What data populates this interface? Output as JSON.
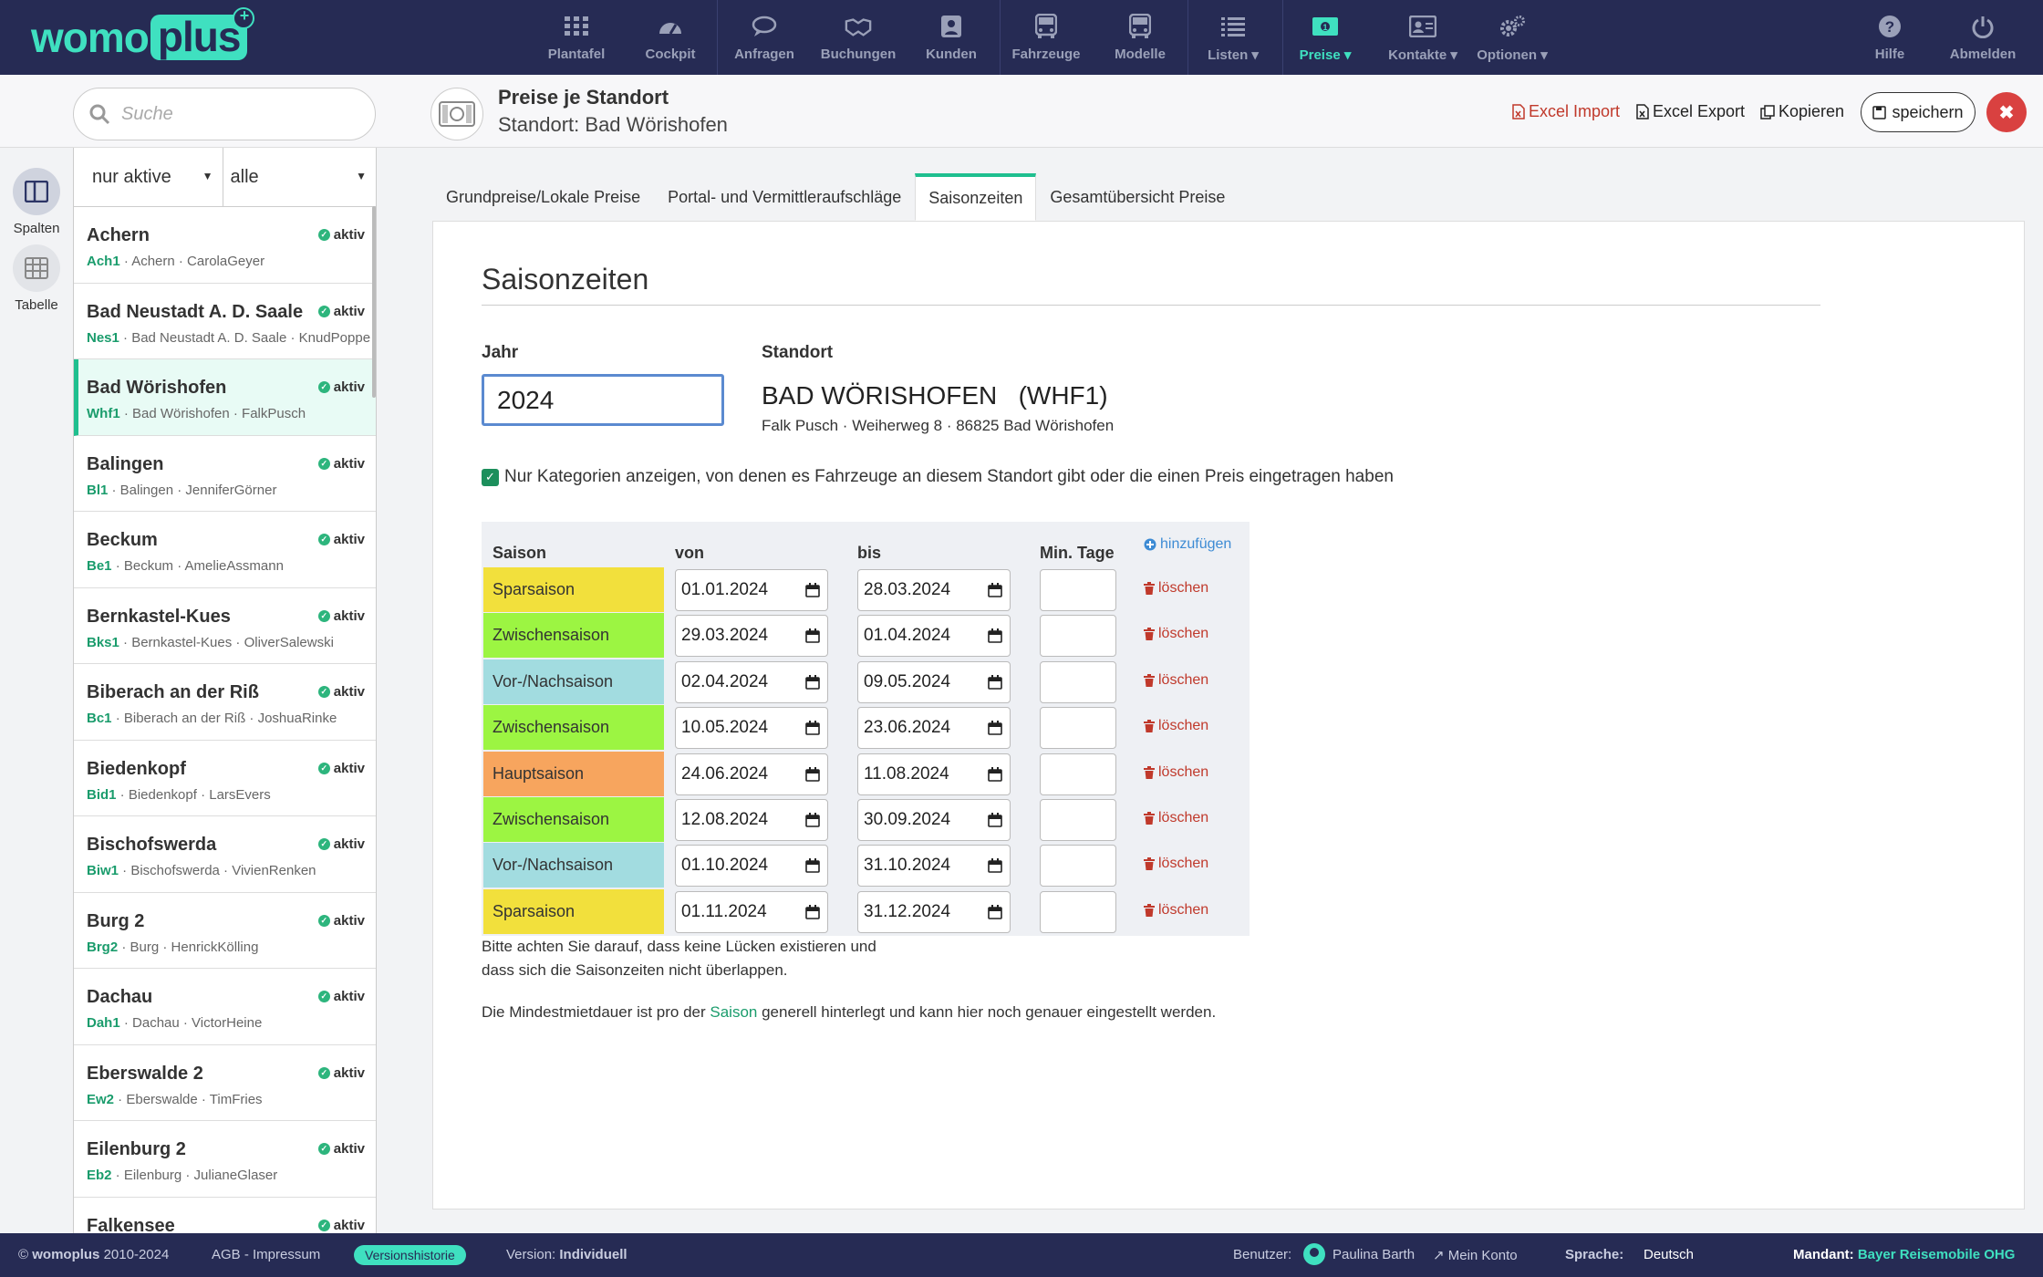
{
  "app": {
    "logo_a": "womo",
    "logo_b": "plus"
  },
  "nav": {
    "items": [
      {
        "label": "Plantafel",
        "icon": "grid-icon"
      },
      {
        "label": "Cockpit",
        "icon": "gauge-icon"
      },
      {
        "label": "Anfragen",
        "icon": "chat-icon"
      },
      {
        "label": "Buchungen",
        "icon": "handshake-icon"
      },
      {
        "label": "Kunden",
        "icon": "person-card-icon"
      },
      {
        "label": "Fahrzeuge",
        "icon": "bus-icon"
      },
      {
        "label": "Modelle",
        "icon": "bus-icon"
      },
      {
        "label": "Listen ▾",
        "icon": "list-icon"
      },
      {
        "label": "Preise ▾",
        "icon": "money-icon"
      },
      {
        "label": "Kontakte ▾",
        "icon": "contact-card-icon"
      },
      {
        "label": "Optionen ▾",
        "icon": "gears-icon"
      },
      {
        "label": "Hilfe",
        "icon": "question-icon"
      },
      {
        "label": "Abmelden",
        "icon": "power-icon"
      }
    ],
    "active": "Preise"
  },
  "search": {
    "placeholder": "Suche"
  },
  "page": {
    "title": "Preise je Standort",
    "subtitle": "Standort: Bad Wörishofen",
    "excel_import": "Excel Import",
    "excel_export": "Excel Export",
    "copy": "Kopieren",
    "save": "speichern"
  },
  "rail": {
    "spalten": "Spalten",
    "tabelle": "Tabelle"
  },
  "filters": {
    "status": "nur aktive",
    "type": "alle"
  },
  "locations": [
    {
      "name": "Achern",
      "code": "Ach1",
      "meta": " · Achern · CarolaGeyer",
      "status": "aktiv"
    },
    {
      "name": "Bad Neustadt A. D. Saale",
      "code": "Nes1",
      "meta": " · Bad Neustadt A. D. Saale · KnudPoppe",
      "status": "aktiv"
    },
    {
      "name": "Bad Wörishofen",
      "code": "Whf1",
      "meta": " · Bad Wörishofen · FalkPusch",
      "status": "aktiv"
    },
    {
      "name": "Balingen",
      "code": "Bl1",
      "meta": " · Balingen · JenniferGörner",
      "status": "aktiv"
    },
    {
      "name": "Beckum",
      "code": "Be1",
      "meta": " · Beckum · AmelieAssmann",
      "status": "aktiv"
    },
    {
      "name": "Bernkastel-Kues",
      "code": "Bks1",
      "meta": " · Bernkastel-Kues · OliverSalewski",
      "status": "aktiv"
    },
    {
      "name": "Biberach an der Riß",
      "code": "Bc1",
      "meta": " · Biberach an der Riß · JoshuaRinke",
      "status": "aktiv"
    },
    {
      "name": "Biedenkopf",
      "code": "Bid1",
      "meta": " · Biedenkopf · LarsEvers",
      "status": "aktiv"
    },
    {
      "name": "Bischofswerda",
      "code": "Biw1",
      "meta": " · Bischofswerda · VivienRenken",
      "status": "aktiv"
    },
    {
      "name": "Burg 2",
      "code": "Brg2",
      "meta": " · Burg · HenrickKölling",
      "status": "aktiv"
    },
    {
      "name": "Dachau",
      "code": "Dah1",
      "meta": " · Dachau · VictorHeine",
      "status": "aktiv"
    },
    {
      "name": "Eberswalde 2",
      "code": "Ew2",
      "meta": " · Eberswalde · TimFries",
      "status": "aktiv"
    },
    {
      "name": "Eilenburg 2",
      "code": "Eb2",
      "meta": " · Eilenburg · JulianeGlaser",
      "status": "aktiv"
    },
    {
      "name": "Falkensee",
      "code": "",
      "meta": "",
      "status": "aktiv"
    }
  ],
  "tabs": [
    "Grundpreise/Lokale Preise",
    "Portal- und Vermittleraufschläge",
    "Saisonzeiten",
    "Gesamtübersicht Preise"
  ],
  "section": {
    "heading": "Saisonzeiten",
    "jahr_label": "Jahr",
    "jahr_value": "2024",
    "standort_label": "Standort",
    "standort_name": "BAD WÖRISHOFEN   (WHF1)",
    "standort_addr": "Falk Pusch · Weiherweg 8 · 86825 Bad Wörishofen",
    "checkbox_label": "Nur Kategorien anzeigen, von denen es Fahrzeuge an diesem Standort gibt oder die einen Preis eingetragen haben"
  },
  "table": {
    "headers": {
      "saison": "Saison",
      "von": "von",
      "bis": "bis",
      "min": "Min. Tage",
      "add": "hinzufügen"
    },
    "delete_label": "löschen",
    "rows": [
      {
        "saison": "Sparsaison",
        "color": "#f2e03c",
        "von": "01.01.2024",
        "bis": "28.03.2024"
      },
      {
        "saison": "Zwischensaison",
        "color": "#9cf542",
        "von": "29.03.2024",
        "bis": "01.04.2024"
      },
      {
        "saison": "Vor-/Nachsaison",
        "color": "#a2dce0",
        "von": "02.04.2024",
        "bis": "09.05.2024"
      },
      {
        "saison": "Zwischensaison",
        "color": "#9cf542",
        "von": "10.05.2024",
        "bis": "23.06.2024"
      },
      {
        "saison": "Hauptsaison",
        "color": "#f7a55e",
        "von": "24.06.2024",
        "bis": "11.08.2024"
      },
      {
        "saison": "Zwischensaison",
        "color": "#9cf542",
        "von": "12.08.2024",
        "bis": "30.09.2024"
      },
      {
        "saison": "Vor-/Nachsaison",
        "color": "#a2dce0",
        "von": "01.10.2024",
        "bis": "31.10.2024"
      },
      {
        "saison": "Sparsaison",
        "color": "#f2e03c",
        "von": "01.11.2024",
        "bis": "31.12.2024"
      }
    ]
  },
  "notes": {
    "line1": "Bitte achten Sie darauf, dass keine Lücken existieren und",
    "line2": "dass sich die Saisonzeiten nicht überlappen.",
    "line3_pre": "Die Mindestmietdauer ist pro der ",
    "line3_link": "Saison",
    "line3_post": " generell hinterlegt und kann hier noch genauer eingestellt werden."
  },
  "footer": {
    "copyright_pre": "© ",
    "copyright_brand": "womoplus",
    "copyright_years": " 2010-2024",
    "agb": "AGB - Impressum",
    "versions": "Versionshistorie",
    "version_label": "Version: ",
    "version_value": "Individuell",
    "user_label": "Benutzer:",
    "user_name": "Paulina Barth",
    "account": "Mein Konto",
    "lang_label": "Sprache:",
    "lang_value": "Deutsch",
    "mandant_label": "Mandant:",
    "mandant_value": "Bayer Reisemobile OHG"
  },
  "colors": {
    "accent": "#3fe0c0",
    "nav_bg": "#262b54",
    "danger": "#d94140",
    "link_green": "#1a9c6c"
  }
}
